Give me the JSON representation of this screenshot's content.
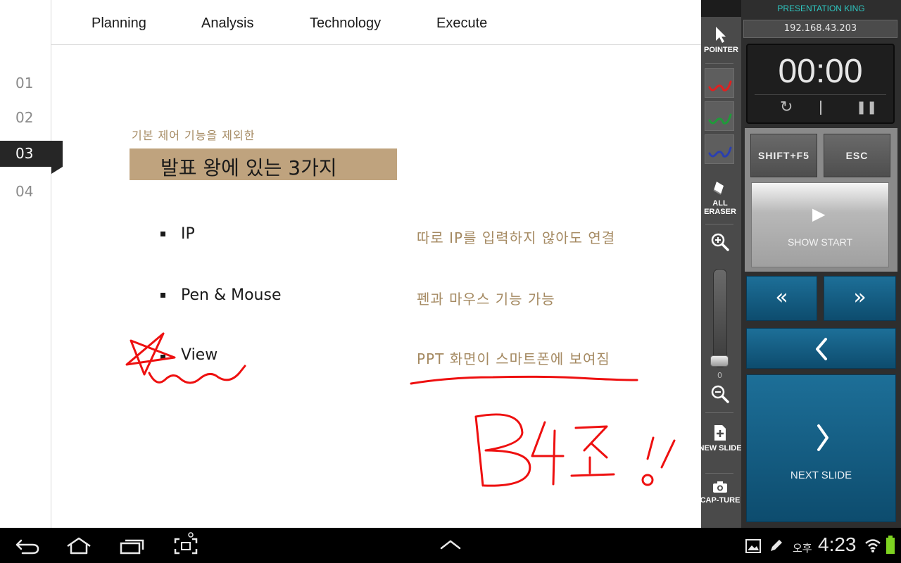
{
  "slide": {
    "nav_tabs": [
      "Planning",
      "Analysis",
      "Technology",
      "Execute"
    ],
    "sections": [
      "01",
      "02",
      "03",
      "04"
    ],
    "active_section": "03",
    "subtitle": "기본 제어 기능을 제외한",
    "title": "발표 왕에 있는 3가지",
    "items": [
      {
        "label": "IP",
        "desc": "따로 IP를 입력하지 않아도 연결"
      },
      {
        "label": "Pen & Mouse",
        "desc": "펜과 마우스 기능 가능"
      },
      {
        "label": "View",
        "desc": "PPT 화면이 스마트폰에 보여짐"
      }
    ]
  },
  "tools": {
    "pointer": "POINTER",
    "eraser": "ALL ERASER",
    "zoom_value": "0",
    "new_slide": "NEW SLIDE",
    "capture": "CAP-TURE",
    "pen_colors": [
      "#e02020",
      "#1f9a3a",
      "#2a3fb0"
    ],
    "icons": [
      "pointer-icon",
      "eraser-icon",
      "zoom-in-icon",
      "zoom-out-icon",
      "new-slide-icon",
      "camera-icon"
    ]
  },
  "panel": {
    "app_title": "PRESENTATION KING",
    "ip": "192.168.43.203",
    "timer": "00:00",
    "key_shift_f5": "SHIFT+F5",
    "key_esc": "ESC",
    "show_start": "SHOW START",
    "next_slide": "NEXT SLIDE",
    "accent_color": "#1d6f98",
    "title_color": "#2fc7c1"
  },
  "system_bar": {
    "ampm": "오후",
    "time": "4:23",
    "icons": [
      "back-icon",
      "home-icon",
      "recent-apps-icon",
      "screenshot-icon",
      "up-chevron-icon",
      "gallery-notification-icon",
      "pen-notification-icon",
      "wifi-icon",
      "battery-icon"
    ]
  }
}
